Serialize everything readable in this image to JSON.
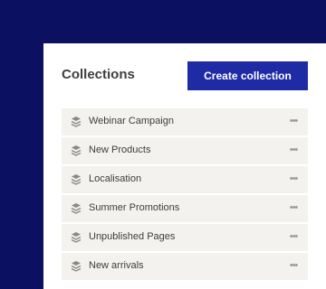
{
  "panel": {
    "title": "Collections",
    "create_button_label": "Create collection"
  },
  "collections": [
    {
      "label": "Webinar Campaign",
      "icon": "layers-icon"
    },
    {
      "label": "New Products",
      "icon": "layers-icon"
    },
    {
      "label": "Localisation",
      "icon": "layers-icon"
    },
    {
      "label": "Summer Promotions",
      "icon": "layers-icon"
    },
    {
      "label": "Unpublished Pages",
      "icon": "layers-icon"
    },
    {
      "label": "New arrivals",
      "icon": "layers-icon"
    }
  ],
  "row_menu_glyph": "•••",
  "colors": {
    "background": "#0b1160",
    "accent": "#1f2ba5",
    "row_background": "#f3f2ee"
  }
}
